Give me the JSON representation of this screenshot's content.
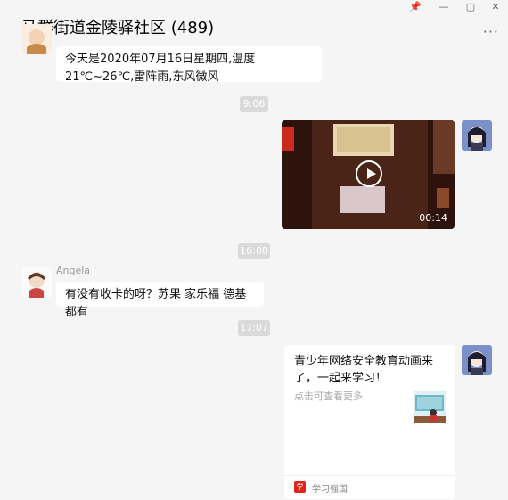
{
  "window": {
    "title": "马群街道金陵驿社区 (489)",
    "controls": [
      "📌",
      "—",
      "▢",
      "✕"
    ],
    "more_label": "···"
  },
  "messages": {
    "weather": "今天是2020年07月16日星期四,温度21℃~26℃,雷阵雨,东风微风",
    "time1": "9:06",
    "video_duration": "00:14",
    "time2": "16:08",
    "angela_name": "Angela",
    "angela_text": "有没有收卡的呀？苏果 家乐福 德基都有",
    "time3": "17:07",
    "card": {
      "title": "青少年网络安全教育动画来了，一起来学习！",
      "desc": "点击可查看更多",
      "app_name": "学习强国"
    }
  },
  "colors": {
    "accent": "#e2231a",
    "bubble": "#ffffff",
    "background": "#f5f5f5"
  }
}
